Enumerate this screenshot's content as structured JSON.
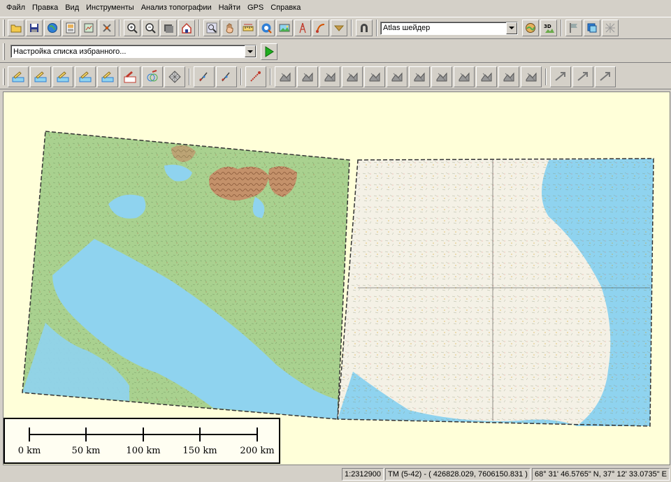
{
  "menu": [
    "Файл",
    "Правка",
    "Вид",
    "Инструменты",
    "Анализ топографии",
    "Найти",
    "GPS",
    "Справка"
  ],
  "toolbar1": {
    "shader_select": "Atlas шейдер",
    "buttons": [
      "open-folder-icon",
      "save-icon",
      "globe-icon",
      "catalog-icon",
      "export-icon",
      "tools-icon",
      "zoom-in-icon",
      "zoom-out-icon",
      "zoom-box-icon",
      "home-icon",
      "zoom-tool-icon",
      "pan-hand-icon",
      "ruler-icon",
      "info-icon",
      "image-icon",
      "tower-icon",
      "route-icon",
      "dropdown-icon",
      "magnet-icon",
      "shader-icon",
      "3d-view-icon",
      "flag-icon",
      "layers-icon",
      "grid-points-icon"
    ]
  },
  "toolbar2": {
    "favorites_select": "Настройка списка избранного...",
    "run_label": "run"
  },
  "toolbar3": {
    "buttons": [
      "layer-1-icon",
      "layer-2-icon",
      "layer-3-icon",
      "contour-icon",
      "layer-4-icon",
      "code-36-icon",
      "circles-icon",
      "grid-icon",
      "point-edit-icon",
      "line-edit-icon",
      "draw-red-icon",
      "terrain-1-icon",
      "terrain-2-icon",
      "terrain-3-icon",
      "terrain-4-icon",
      "terrain-5-icon",
      "terrain-6-icon",
      "terrain-7-icon",
      "terrain-8-icon",
      "terrain-9-icon",
      "terrain-10-icon",
      "terrain-11-icon",
      "terrain-12-icon",
      "arrow-1-icon",
      "arrow-2-icon",
      "arrow-3-icon"
    ]
  },
  "scale": {
    "labels": [
      "0 km",
      "50 km",
      "100 km",
      "150 km",
      "200 km"
    ]
  },
  "status": {
    "scale": "1:2312900",
    "projection": "TM (5-42) - ( 426828.029, 7606150.831 )",
    "coords": "68° 31' 46.5765\" N, 37° 12' 33.0735\" E"
  },
  "colors": {
    "map_background": "#ffffd9",
    "land_green": "#a9d18f",
    "water_blue": "#8fd3ef",
    "relief_brown": "#b07a55"
  }
}
